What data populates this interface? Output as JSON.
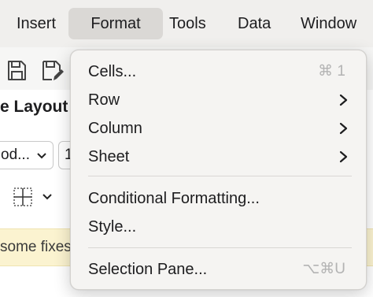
{
  "menubar": {
    "items": [
      {
        "label": "Insert",
        "active": false
      },
      {
        "label": "Format",
        "active": true
      },
      {
        "label": "Tools",
        "active": false
      },
      {
        "label": "Data",
        "active": false
      },
      {
        "label": "Window",
        "active": false
      }
    ]
  },
  "window": {
    "heading_fragment": "e Layout",
    "font_select_value": "od...",
    "size_select_value": "1",
    "notice_fragment": "some fixes"
  },
  "format_menu": {
    "items": [
      {
        "label": "Cells...",
        "shortcut": "⌘ 1",
        "submenu": false
      },
      {
        "label": "Row",
        "shortcut": "",
        "submenu": true
      },
      {
        "label": "Column",
        "shortcut": "",
        "submenu": true
      },
      {
        "label": "Sheet",
        "shortcut": "",
        "submenu": true
      },
      {
        "label": "Conditional Formatting...",
        "shortcut": "",
        "submenu": false
      },
      {
        "label": "Style...",
        "shortcut": "",
        "submenu": false
      },
      {
        "label": "Selection Pane...",
        "shortcut": "⌥⌘U",
        "submenu": false
      }
    ]
  },
  "colors": {
    "menubar_bg": "#f0efed",
    "menu_bg": "#f5f4f2",
    "active_highlight": "#dad8d5",
    "shortcut_text": "#b3b3b3",
    "notice_bg": "#fbf3d0"
  }
}
